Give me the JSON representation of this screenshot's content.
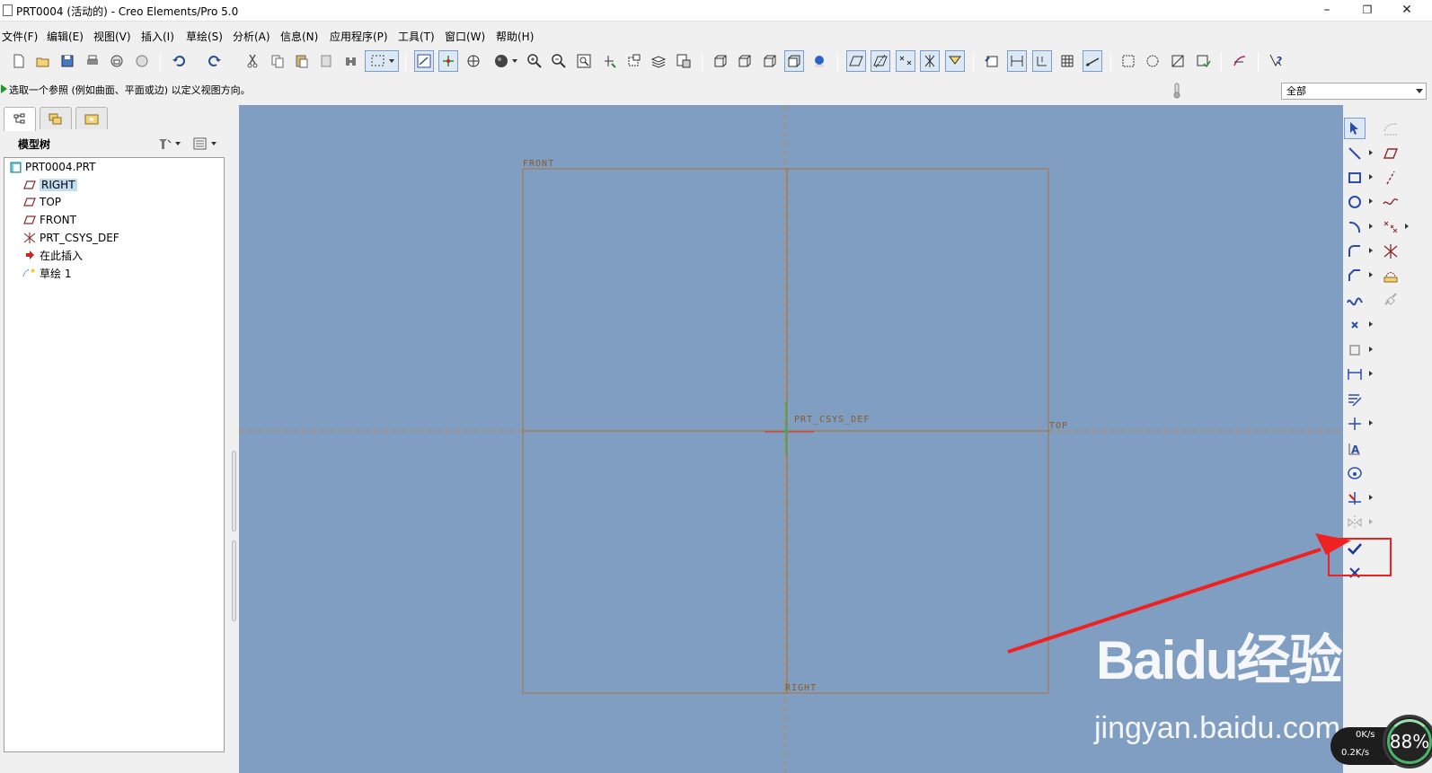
{
  "window": {
    "title": "PRT0004 (活动的) - Creo Elements/Pro 5.0",
    "controls": {
      "minimize": "–",
      "restore": "❐",
      "close": "✕"
    }
  },
  "menu": [
    "文件(F)",
    "编辑(E)",
    "视图(V)",
    "插入(I)",
    "草绘(S)",
    "分析(A)",
    "信息(N)",
    "应用程序(P)",
    "工具(T)",
    "窗口(W)",
    "帮助(H)"
  ],
  "toolbar": {
    "icons": [
      "new-icon",
      "open-icon",
      "save-icon",
      "print-icon",
      "email-icon",
      "email-link-icon",
      "undo-icon",
      "redo-icon",
      "cut-icon",
      "copy-icon",
      "paste-icon",
      "paste-special-icon",
      "regenerate-icon",
      "select-box-icon",
      "sketch-view-icon",
      "spin-center-icon",
      "orient-mode-icon",
      "shading-icon",
      "zoom-in-icon",
      "zoom-out-icon",
      "refit-icon",
      "reorient-icon",
      "saved-views-icon",
      "layers-icon",
      "view-manager-icon",
      "wireframe-icon",
      "hidden-line-icon",
      "no-hidden-icon",
      "shaded-icon",
      "enhanced-realism-icon",
      "datum-planes-icon",
      "datum-axes-icon",
      "datum-points-icon",
      "coordinate-systems-icon",
      "annotation-display-icon",
      "sketch-orient-icon",
      "disp-dimensions-icon",
      "disp-constraints-icon",
      "disp-grid-icon",
      "disp-vertices-icon",
      "diagnostics-open-icon",
      "diagnostics-overlap-icon",
      "diagnostics-shade-icon",
      "diagnostics-locks-icon",
      "sketch-tool-icon",
      "context-help-icon"
    ]
  },
  "message": {
    "text": "选取一个参照 (例如曲面、平面或边) 以定义视图方向。"
  },
  "filter": {
    "value": "全部"
  },
  "model_tree": {
    "header": "模型树",
    "tabs": [
      "model-tree-tab",
      "folder-browser-tab",
      "favorites-tab"
    ],
    "items": [
      {
        "label": "PRT0004.PRT",
        "icon": "part-icon"
      },
      {
        "label": "RIGHT",
        "icon": "datum-plane-icon",
        "selected": true
      },
      {
        "label": "TOP",
        "icon": "datum-plane-icon"
      },
      {
        "label": "FRONT",
        "icon": "datum-plane-icon"
      },
      {
        "label": "PRT_CSYS_DEF",
        "icon": "csys-icon"
      },
      {
        "label": "在此插入",
        "icon": "insert-here-icon"
      },
      {
        "label": "草绘 1",
        "icon": "sketch-icon"
      }
    ]
  },
  "graphics": {
    "labels": {
      "front": "FRONT",
      "top": "TOP",
      "right": "RIGHT",
      "csys": "PRT_CSYS_DEF"
    },
    "background": "#7f9ec2",
    "datum_color": "#b07a3c"
  },
  "sketch_toolbar": {
    "icons": [
      "select-icon",
      "line-icon",
      "rectangle-icon",
      "circle-icon",
      "arc-icon",
      "fillet-icon",
      "chamfer-icon",
      "spline-icon",
      "point-icon",
      "offset-icon",
      "dimension-icon",
      "modify-icon",
      "constraint-icon",
      "text-icon",
      "palette-icon",
      "trim-icon",
      "mirror-icon",
      "done-check-icon",
      "quit-x-icon"
    ],
    "right_column_icons": [
      "intent-manager-icon",
      "datum-plane-tool-icon",
      "datum-axis-tool-icon",
      "datum-curve-tool-icon",
      "datum-point-tool-icon",
      "csys-tool-icon",
      "analysis-feature-icon",
      "chain-icon"
    ]
  },
  "watermark": {
    "brand": "Baidu经验",
    "url": "jingyan.baidu.com"
  },
  "net_monitor": {
    "upload": "0K/s",
    "download": "0.2K/s",
    "percent": "88%"
  }
}
